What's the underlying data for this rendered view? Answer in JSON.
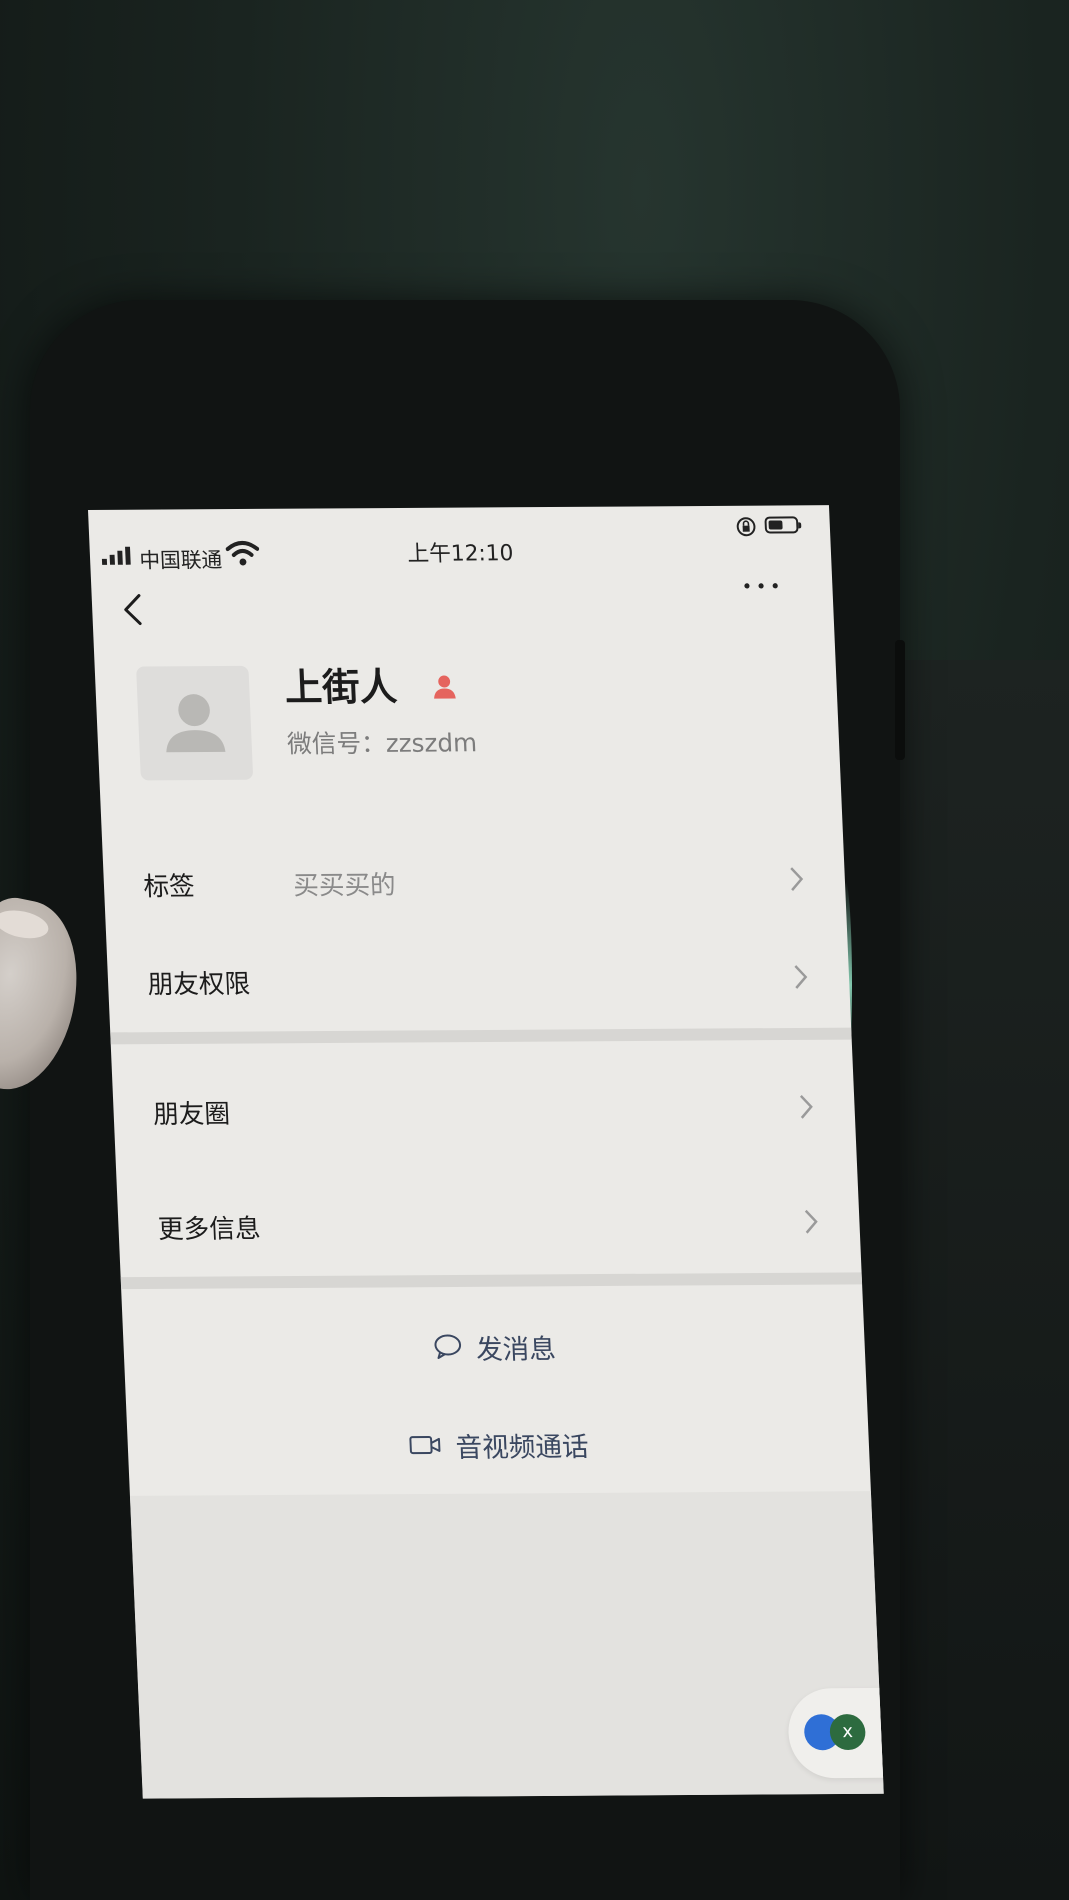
{
  "status_bar": {
    "carrier": "中国联通",
    "time": "上午12:10",
    "battery_level": 0.55
  },
  "nav": {
    "back_icon": "chevron-left-icon",
    "more_icon": "ellipsis-icon"
  },
  "profile": {
    "avatar_icon": "default-person-avatar",
    "name": "上街人",
    "gender_icon": "person-badge-icon",
    "wechat_id": "微信号：zzszdm"
  },
  "rows": [
    {
      "label": "标签",
      "value": "买买买的"
    },
    {
      "label": "朋友权限",
      "value": ""
    },
    {
      "label": "朋友圈",
      "value": ""
    },
    {
      "label": "更多信息",
      "value": ""
    }
  ],
  "actions": {
    "send_message": "发消息",
    "video_call": "音视频通话"
  },
  "floating": {
    "close_label": "x"
  },
  "colors": {
    "screen_bg": "#ebeae7",
    "action_text": "#3a4760",
    "badge": "#e5645e"
  }
}
